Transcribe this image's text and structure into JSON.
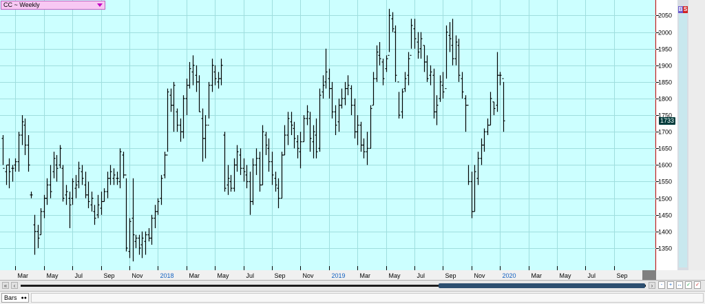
{
  "window": {
    "title": "CC ~ Weekly"
  },
  "panel": {
    "bs_b": "B",
    "bs_s": "S",
    "bars_tab": "Bars"
  },
  "colors": {
    "plot_bg": "#ccffff",
    "grid": "#9edede",
    "bar": "#000000",
    "price_tag": "#003c3c",
    "separator": "#c00000"
  },
  "chart_data": {
    "type": "ohlc",
    "ylim": [
      1300,
      2080
    ],
    "yticks": [
      1350,
      1400,
      1450,
      1500,
      1550,
      1600,
      1650,
      1700,
      1750,
      1800,
      1850,
      1900,
      1950,
      2000,
      2050
    ],
    "ytick_labels": [
      "1350",
      "1400",
      "1450",
      "1500",
      "1550",
      "1600",
      "1650",
      "1700",
      "1750",
      "1800",
      "1850",
      "1900",
      "1950",
      "2000",
      "2050"
    ],
    "last_price": "1733",
    "last_price_value": 1733,
    "xticks": [
      {
        "label": "Mar",
        "year": false,
        "idx": 4
      },
      {
        "label": "May",
        "year": false,
        "idx": 13
      },
      {
        "label": "Jul",
        "year": false,
        "idx": 22
      },
      {
        "label": "Sep",
        "year": false,
        "idx": 31
      },
      {
        "label": "Nov",
        "year": false,
        "idx": 40
      },
      {
        "label": "2018",
        "year": true,
        "idx": 49
      },
      {
        "label": "Mar",
        "year": false,
        "idx": 58
      },
      {
        "label": "May",
        "year": false,
        "idx": 67
      },
      {
        "label": "Jul",
        "year": false,
        "idx": 76
      },
      {
        "label": "Sep",
        "year": false,
        "idx": 85
      },
      {
        "label": "Nov",
        "year": false,
        "idx": 94
      },
      {
        "label": "2019",
        "year": true,
        "idx": 103
      },
      {
        "label": "Mar",
        "year": false,
        "idx": 112
      },
      {
        "label": "May",
        "year": false,
        "idx": 121
      },
      {
        "label": "Jul",
        "year": false,
        "idx": 130
      },
      {
        "label": "Sep",
        "year": false,
        "idx": 139
      },
      {
        "label": "Nov",
        "year": false,
        "idx": 148
      },
      {
        "label": "2020",
        "year": true,
        "idx": 157
      },
      {
        "label": "Mar",
        "year": false,
        "idx": 166
      },
      {
        "label": "May",
        "year": false,
        "idx": 175
      },
      {
        "label": "Jul",
        "year": false,
        "idx": 184
      },
      {
        "label": "Sep",
        "year": false,
        "idx": 193
      }
    ],
    "bars": [
      [
        1690,
        1600,
        1680,
        1590
      ],
      [
        1600,
        1540,
        1580,
        1600
      ],
      [
        1620,
        1530,
        1600,
        1580
      ],
      [
        1600,
        1550,
        1590,
        1590
      ],
      [
        1620,
        1580,
        1600,
        1610
      ],
      [
        1700,
        1580,
        1610,
        1690
      ],
      [
        1750,
        1660,
        1690,
        1730
      ],
      [
        1740,
        1630,
        1720,
        1660
      ],
      [
        1690,
        1580,
        1660,
        1600
      ],
      [
        1520,
        1500,
        1510,
        1510
      ],
      [
        1450,
        1330,
        1420,
        1400
      ],
      [
        1420,
        1350,
        1400,
        1380
      ],
      [
        1470,
        1390,
        1390,
        1460
      ],
      [
        1510,
        1440,
        1460,
        1500
      ],
      [
        1560,
        1480,
        1500,
        1540
      ],
      [
        1600,
        1500,
        1540,
        1520
      ],
      [
        1640,
        1560,
        1580,
        1620
      ],
      [
        1630,
        1550,
        1600,
        1590
      ],
      [
        1660,
        1590,
        1600,
        1650
      ],
      [
        1600,
        1490,
        1590,
        1500
      ],
      [
        1540,
        1480,
        1510,
        1520
      ],
      [
        1520,
        1410,
        1500,
        1480
      ],
      [
        1560,
        1480,
        1500,
        1550
      ],
      [
        1570,
        1500,
        1530,
        1540
      ],
      [
        1610,
        1530,
        1550,
        1590
      ],
      [
        1600,
        1540,
        1580,
        1560
      ],
      [
        1580,
        1500,
        1540,
        1510
      ],
      [
        1550,
        1470,
        1510,
        1490
      ],
      [
        1520,
        1460,
        1480,
        1500
      ],
      [
        1480,
        1420,
        1460,
        1440
      ],
      [
        1510,
        1440,
        1450,
        1480
      ],
      [
        1520,
        1450,
        1470,
        1490
      ],
      [
        1530,
        1490,
        1490,
        1520
      ],
      [
        1580,
        1500,
        1520,
        1560
      ],
      [
        1600,
        1540,
        1560,
        1580
      ],
      [
        1590,
        1540,
        1560,
        1570
      ],
      [
        1580,
        1540,
        1560,
        1560
      ],
      [
        1650,
        1530,
        1550,
        1640
      ],
      [
        1640,
        1560,
        1630,
        1570
      ],
      [
        1560,
        1340,
        1570,
        1350
      ],
      [
        1440,
        1320,
        1340,
        1430
      ],
      [
        1560,
        1310,
        1440,
        1390
      ],
      [
        1390,
        1350,
        1370,
        1380
      ],
      [
        1390,
        1330,
        1380,
        1350
      ],
      [
        1400,
        1320,
        1360,
        1380
      ],
      [
        1400,
        1330,
        1370,
        1390
      ],
      [
        1410,
        1370,
        1390,
        1380
      ],
      [
        1450,
        1360,
        1380,
        1440
      ],
      [
        1480,
        1410,
        1440,
        1460
      ],
      [
        1500,
        1450,
        1460,
        1490
      ],
      [
        1570,
        1480,
        1500,
        1560
      ],
      [
        1640,
        1560,
        1570,
        1630
      ],
      [
        1830,
        1640,
        1630,
        1820
      ],
      [
        1830,
        1760,
        1810,
        1780
      ],
      [
        1850,
        1700,
        1780,
        1840
      ],
      [
        1770,
        1700,
        1760,
        1720
      ],
      [
        1740,
        1670,
        1720,
        1700
      ],
      [
        1810,
        1680,
        1700,
        1800
      ],
      [
        1860,
        1750,
        1800,
        1840
      ],
      [
        1910,
        1830,
        1840,
        1890
      ],
      [
        1930,
        1840,
        1880,
        1900
      ],
      [
        1900,
        1820,
        1870,
        1850
      ],
      [
        1870,
        1760,
        1850,
        1760
      ],
      [
        1770,
        1610,
        1740,
        1680
      ],
      [
        1750,
        1620,
        1680,
        1720
      ],
      [
        1850,
        1740,
        1720,
        1840
      ],
      [
        1920,
        1820,
        1840,
        1900
      ],
      [
        1900,
        1840,
        1880,
        1860
      ],
      [
        1880,
        1830,
        1850,
        1860
      ],
      [
        1920,
        1840,
        1860,
        1900
      ],
      [
        1700,
        1520,
        1690,
        1530
      ],
      [
        1600,
        1510,
        1540,
        1560
      ],
      [
        1570,
        1520,
        1550,
        1530
      ],
      [
        1620,
        1520,
        1530,
        1600
      ],
      [
        1660,
        1580,
        1600,
        1640
      ],
      [
        1650,
        1570,
        1630,
        1590
      ],
      [
        1620,
        1550,
        1590,
        1580
      ],
      [
        1600,
        1530,
        1570,
        1550
      ],
      [
        1580,
        1450,
        1550,
        1490
      ],
      [
        1620,
        1480,
        1490,
        1600
      ],
      [
        1650,
        1570,
        1600,
        1620
      ],
      [
        1640,
        1520,
        1620,
        1540
      ],
      [
        1720,
        1540,
        1540,
        1700
      ],
      [
        1700,
        1630,
        1690,
        1660
      ],
      [
        1680,
        1580,
        1650,
        1610
      ],
      [
        1640,
        1540,
        1610,
        1570
      ],
      [
        1580,
        1520,
        1560,
        1540
      ],
      [
        1560,
        1470,
        1530,
        1500
      ],
      [
        1640,
        1500,
        1500,
        1630
      ],
      [
        1720,
        1630,
        1630,
        1690
      ],
      [
        1760,
        1660,
        1690,
        1740
      ],
      [
        1760,
        1690,
        1730,
        1720
      ],
      [
        1730,
        1650,
        1710,
        1680
      ],
      [
        1690,
        1620,
        1670,
        1650
      ],
      [
        1700,
        1590,
        1640,
        1670
      ],
      [
        1750,
        1670,
        1670,
        1740
      ],
      [
        1780,
        1720,
        1740,
        1760
      ],
      [
        1760,
        1640,
        1740,
        1680
      ],
      [
        1720,
        1620,
        1670,
        1700
      ],
      [
        1740,
        1620,
        1690,
        1640
      ],
      [
        1830,
        1640,
        1650,
        1810
      ],
      [
        1870,
        1800,
        1820,
        1840
      ],
      [
        1950,
        1830,
        1850,
        1880
      ],
      [
        1890,
        1800,
        1860,
        1830
      ],
      [
        1850,
        1740,
        1830,
        1760
      ],
      [
        1780,
        1690,
        1760,
        1720
      ],
      [
        1800,
        1700,
        1730,
        1780
      ],
      [
        1830,
        1770,
        1780,
        1800
      ],
      [
        1850,
        1780,
        1800,
        1830
      ],
      [
        1870,
        1810,
        1830,
        1840
      ],
      [
        1840,
        1750,
        1830,
        1780
      ],
      [
        1800,
        1680,
        1780,
        1700
      ],
      [
        1750,
        1660,
        1700,
        1720
      ],
      [
        1730,
        1640,
        1720,
        1660
      ],
      [
        1680,
        1620,
        1660,
        1640
      ],
      [
        1700,
        1600,
        1640,
        1650
      ],
      [
        1780,
        1650,
        1650,
        1770
      ],
      [
        1880,
        1780,
        1780,
        1860
      ],
      [
        1960,
        1850,
        1860,
        1940
      ],
      [
        1970,
        1900,
        1930,
        1920
      ],
      [
        1920,
        1840,
        1910,
        1860
      ],
      [
        1930,
        1880,
        1890,
        1920
      ],
      [
        2070,
        1940,
        1930,
        2050
      ],
      [
        2060,
        2000,
        2040,
        2010
      ],
      [
        2020,
        1850,
        2000,
        1870
      ],
      [
        1820,
        1740,
        1850,
        1750
      ],
      [
        1830,
        1740,
        1760,
        1820
      ],
      [
        1880,
        1820,
        1830,
        1860
      ],
      [
        1940,
        1840,
        1870,
        1920
      ],
      [
        2040,
        1950,
        1930,
        2020
      ],
      [
        2040,
        1950,
        2010,
        1980
      ],
      [
        2000,
        1920,
        1970,
        1940
      ],
      [
        2000,
        1920,
        1950,
        1980
      ],
      [
        1960,
        1880,
        1960,
        1910
      ],
      [
        1930,
        1850,
        1910,
        1860
      ],
      [
        1900,
        1840,
        1870,
        1880
      ],
      [
        1890,
        1740,
        1870,
        1760
      ],
      [
        1810,
        1720,
        1760,
        1780
      ],
      [
        1870,
        1790,
        1800,
        1850
      ],
      [
        1880,
        1800,
        1840,
        1820
      ],
      [
        2020,
        1860,
        1830,
        2000
      ],
      [
        2030,
        1940,
        1990,
        1980
      ],
      [
        2040,
        1900,
        1960,
        1920
      ],
      [
        1990,
        1900,
        1920,
        1970
      ],
      [
        1980,
        1850,
        1960,
        1870
      ],
      [
        1880,
        1800,
        1860,
        1820
      ],
      [
        1810,
        1700,
        1800,
        1780
      ],
      [
        1600,
        1540,
        1780,
        1550
      ],
      [
        1580,
        1440,
        1550,
        1460
      ],
      [
        1600,
        1460,
        1460,
        1580
      ],
      [
        1640,
        1540,
        1560,
        1620
      ],
      [
        1680,
        1600,
        1620,
        1660
      ],
      [
        1710,
        1640,
        1660,
        1700
      ],
      [
        1740,
        1690,
        1700,
        1720
      ],
      [
        1820,
        1720,
        1720,
        1800
      ],
      [
        1790,
        1750,
        1790,
        1770
      ],
      [
        1940,
        1760,
        1780,
        1870
      ],
      [
        1880,
        1840,
        1870,
        1870
      ],
      [
        1850,
        1700,
        1860,
        1733
      ]
    ]
  }
}
